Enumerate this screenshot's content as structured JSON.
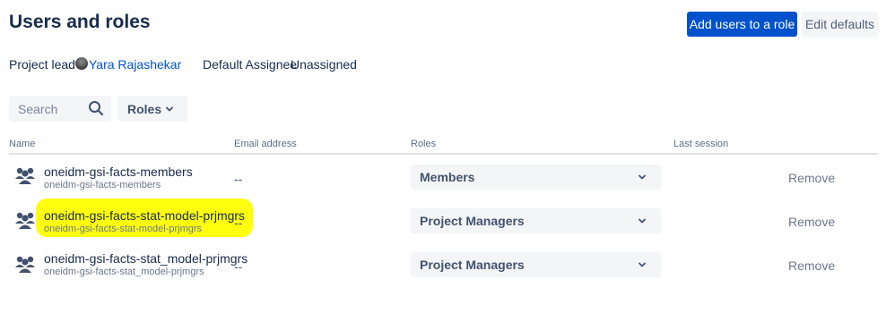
{
  "header": {
    "title": "Users and roles",
    "add_users_label": "Add users to a role",
    "edit_defaults_label": "Edit defaults"
  },
  "meta": {
    "project_lead_label": "Project lead",
    "project_lead_name": "Yara Rajashekar",
    "default_assignee_label": "Default Assignee",
    "default_assignee_value": "Unassigned"
  },
  "filters": {
    "search_placeholder": "Search",
    "roles_label": "Roles"
  },
  "table": {
    "headers": [
      "Name",
      "Email address",
      "Roles",
      "Last session"
    ],
    "rows": [
      {
        "name": "oneidm-gsi-facts-members",
        "subname": "oneidm-gsi-facts-members",
        "email": "--",
        "role": "Members",
        "remove_label": "Remove",
        "highlighted": false
      },
      {
        "name": "oneidm-gsi-facts-stat-model-prjmgrs",
        "subname": "oneidm-gsi-facts-stat-model-prjmgrs",
        "email": "--",
        "role": "Project Managers",
        "remove_label": "Remove",
        "highlighted": true
      },
      {
        "name": "oneidm-gsi-facts-stat_model-prjmgrs",
        "subname": "oneidm-gsi-facts-stat_model-prjmgrs",
        "email": "--",
        "role": "Project Managers",
        "remove_label": "Remove",
        "highlighted": false
      }
    ]
  },
  "colors": {
    "primary": "#0052cc",
    "highlight": "#ffff00",
    "text": "#172b4d",
    "subtle": "#f4f5f7"
  },
  "icons": {
    "search": "search-icon",
    "chevron": "chevron-down-icon",
    "group": "group-icon"
  }
}
